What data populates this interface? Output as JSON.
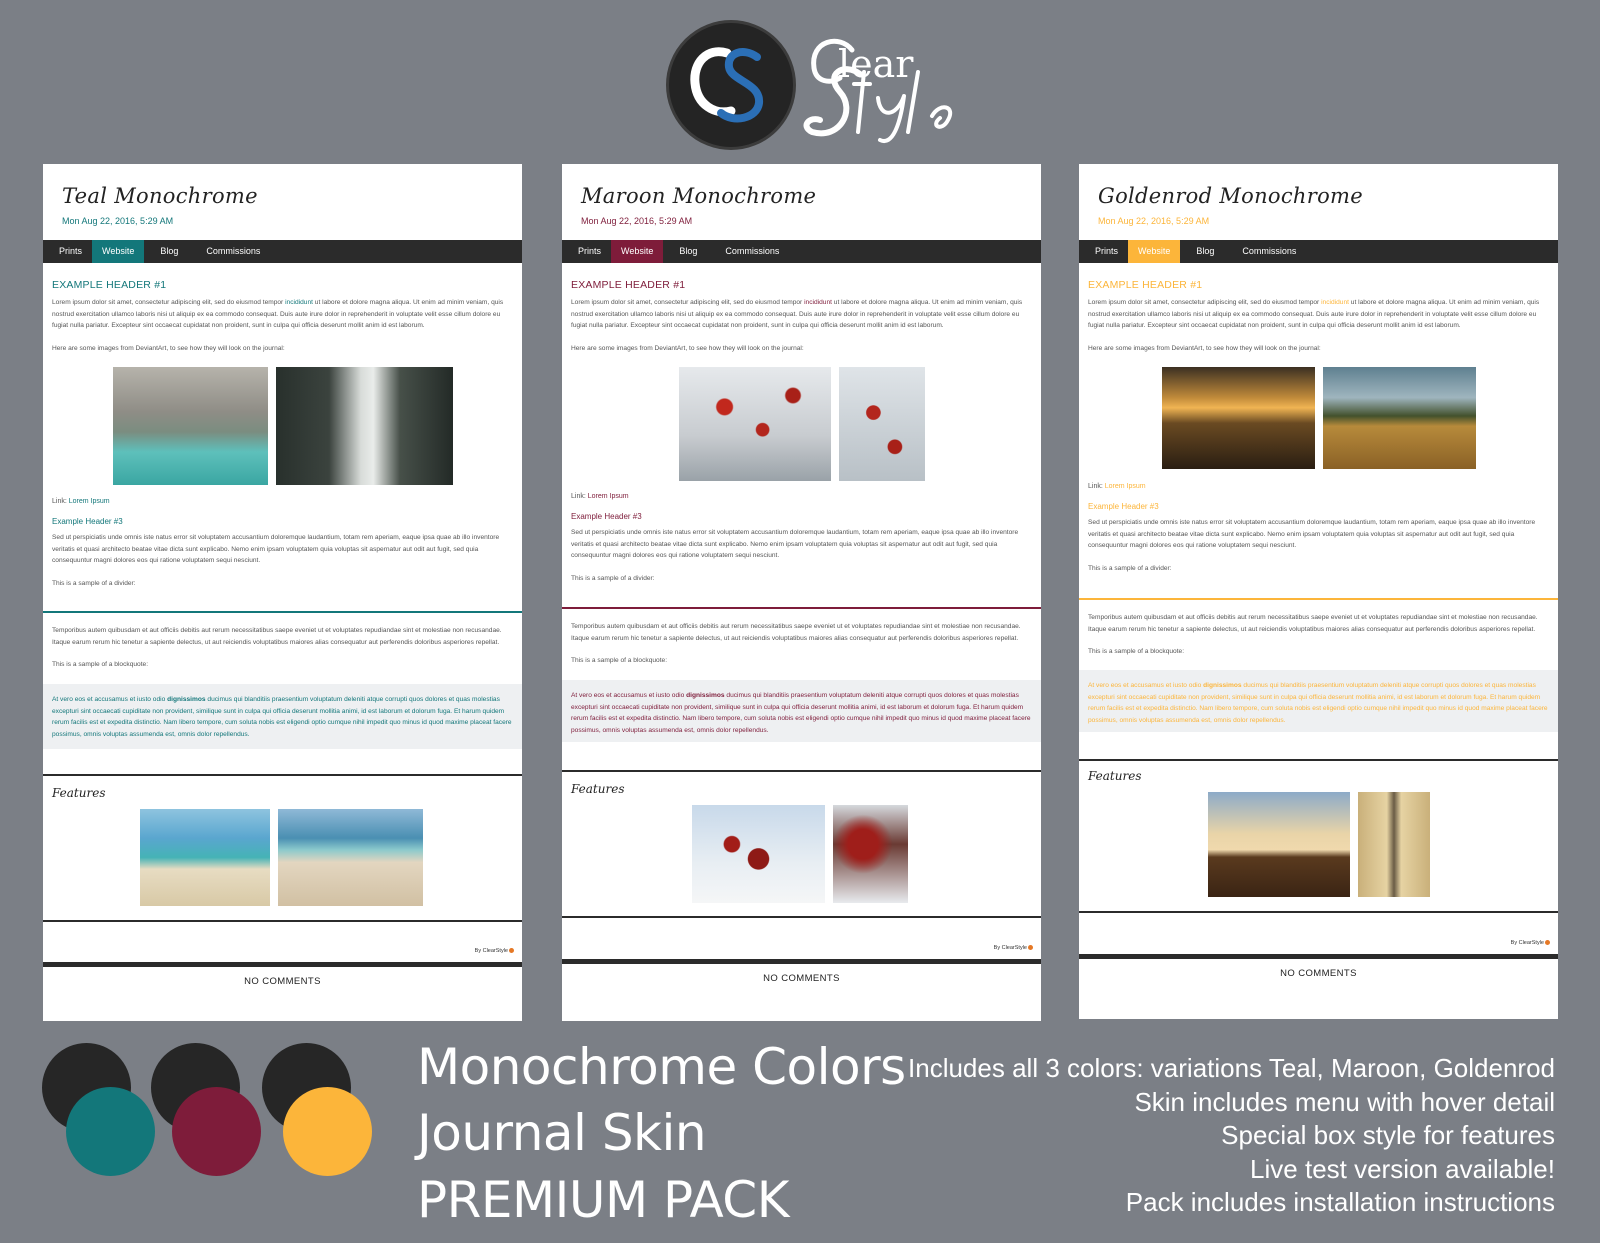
{
  "brand": {
    "logo_text": "CS",
    "wordmark_top": "lear",
    "wordmark_bottom": "Style",
    "wordmark_initial": "C",
    "wordmark_initial2": "S"
  },
  "colors": {
    "teal": "#13777a",
    "maroon": "#7e1c3a",
    "gold": "#fcb53a",
    "dark": "#2b2b2b",
    "background": "#7b7f86"
  },
  "menu": [
    "Prints",
    "Website",
    "Blog",
    "Commissions"
  ],
  "journal": {
    "date": "Mon Aug 22, 2016, 5:29 AM",
    "header1": "EXAMPLE HEADER #1",
    "para1_a": "Lorem ipsum dolor sit amet, consectetur adipiscing elit, sed do eiusmod tempor ",
    "para1_hl": "incididunt",
    "para1_b": " ut labore et dolore magna aliqua. Ut enim ad minim veniam, quis nostrud exercitation ullamco laboris nisi ut aliquip ex ea commodo consequat. Duis aute irure dolor in reprehenderit in voluptate velit esse cillum dolore eu fugiat nulla pariatur. Excepteur sint occaecat cupidatat non proident, sunt in culpa qui officia deserunt mollit anim id est laborum.",
    "para2": "Here are some images from DeviantArt, to see how they will look on the journal:",
    "link_label": "Link:",
    "link_text": "Lorem Ipsum",
    "header3": "Example Header #3",
    "para3": "Sed ut perspiciatis unde omnis iste natus error sit voluptatem accusantium doloremque laudantium, totam rem aperiam, eaque ipsa quae ab illo inventore veritatis et quasi architecto beatae vitae dicta sunt explicabo. Nemo enim ipsam voluptatem quia voluptas sit aspernatur aut odit aut fugit, sed quia consequuntur magni dolores eos qui ratione voluptatem sequi nesciunt.",
    "divider_label": "This is a sample of a divider:",
    "para4": "Temporibus autem quibusdam et aut officiis debitis aut rerum necessitatibus saepe eveniet ut et voluptates repudiandae sint et molestiae non recusandae. Itaque earum rerum hic tenetur a sapiente delectus, ut aut reiciendis voluptatibus maiores alias consequatur aut perferendis doloribus asperiores repellat.",
    "blockquote_label": "This is a sample of a blockquote:",
    "quote_a": "At vero eos et accusamus et iusto odio ",
    "quote_b": "dignissimos",
    "quote_c": " ducimus qui blanditiis praesentium voluptatum deleniti atque corrupti quos dolores et quas molestias excepturi sint occaecati cupiditate non provident, similique sunt in culpa qui officia deserunt mollitia animi, id est laborum et dolorum fuga. Et harum quidem rerum facilis est et expedita distinctio. Nam libero tempore, cum soluta nobis est eligendi optio cumque nihil impedit quo minus id quod maxime placeat facere possimus, omnis voluptas assumenda est, omnis dolor repellendus.",
    "features": "Features",
    "by": "By ClearStyle",
    "no_comments": "NO COMMENTS"
  },
  "cards": [
    {
      "title": "Teal Monochrome",
      "accent": "#13777a"
    },
    {
      "title": "Maroon Monochrome",
      "accent": "#7e1c3a"
    },
    {
      "title": "Goldenrod Monochrome",
      "accent": "#fcb53a"
    }
  ],
  "headline": [
    "Monochrome Colors",
    "Journal Skin",
    "PREMIUM PACK"
  ],
  "feature_list": [
    "Includes all 3 colors: variations Teal, Maroon, Goldenrod",
    "Skin includes menu with hover detail",
    "Special box style for features",
    "Live test version available!",
    "Pack includes installation instructions"
  ]
}
